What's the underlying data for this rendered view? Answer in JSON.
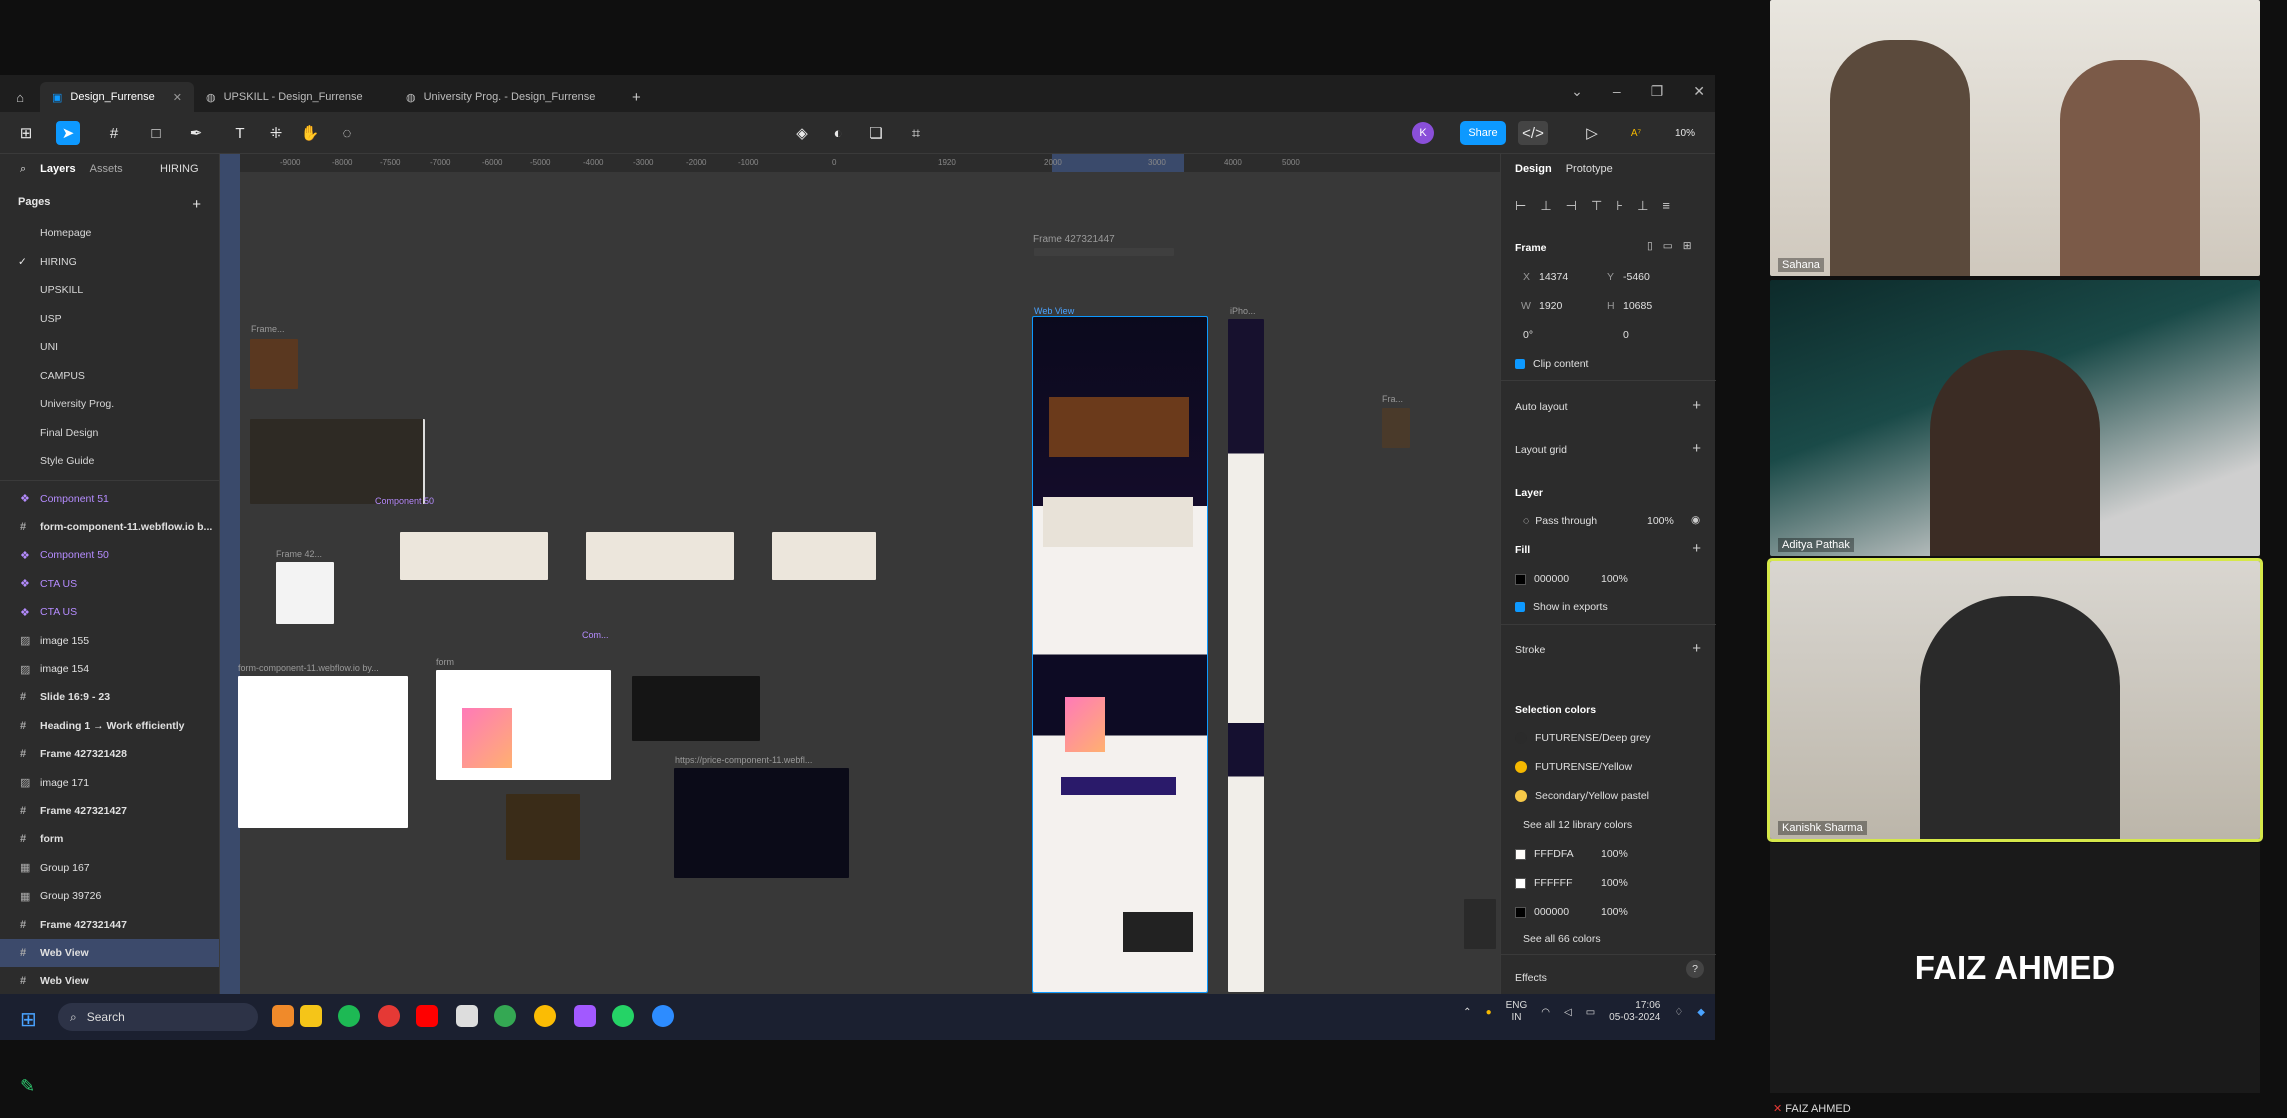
{
  "tabs": [
    "Design_Furrense",
    "UPSKILL - Design_Furrense",
    "University Prog. - Design_Furrense"
  ],
  "toolbar": {
    "share": "Share",
    "avatar": "K",
    "zoom": "10%"
  },
  "left_panel": {
    "tab_layers": "Layers",
    "tab_assets": "Assets",
    "project": "HIRING",
    "pages_title": "Pages",
    "pages": [
      "Homepage",
      "HIRING",
      "UPSKILL",
      "USP",
      "UNI",
      "CAMPUS",
      "University Prog.",
      "Final Design",
      "Style Guide"
    ],
    "layers": [
      {
        "label": "Component 51",
        "kind": "comp"
      },
      {
        "label": "form-component-11.webflow.io b...",
        "kind": "frame"
      },
      {
        "label": "Component 50",
        "kind": "comp"
      },
      {
        "label": "CTA US",
        "kind": "comp"
      },
      {
        "label": "CTA US",
        "kind": "comp"
      },
      {
        "label": "image 155",
        "kind": "image"
      },
      {
        "label": "image 154",
        "kind": "image"
      },
      {
        "label": "Slide 16:9 - 23",
        "kind": "frame"
      },
      {
        "label": "Heading 1 → Work efficiently",
        "kind": "frame"
      },
      {
        "label": "Frame 427321428",
        "kind": "frame"
      },
      {
        "label": "image 171",
        "kind": "image"
      },
      {
        "label": "Frame 427321427",
        "kind": "frame"
      },
      {
        "label": "form",
        "kind": "frame"
      },
      {
        "label": "Group 167",
        "kind": "group"
      },
      {
        "label": "Group 39726",
        "kind": "group"
      },
      {
        "label": "Frame 427321447",
        "kind": "frame"
      },
      {
        "label": "Web View",
        "kind": "frame"
      },
      {
        "label": "Web View",
        "kind": "frame"
      }
    ]
  },
  "rulers": [
    "-9000",
    "-8000",
    "-7500",
    "-7000",
    "-6000",
    "-5000",
    "-4000",
    "-3000",
    "-2000",
    "-1000",
    "0",
    "1920",
    "2000",
    "3000",
    "4000",
    "5000"
  ],
  "canvas": {
    "frame_label_top": "Frame 427321447",
    "web_view_label": "Web View",
    "iphone_label": "iPho...",
    "frame_small_label": "Frame...",
    "component50_label": "Component 50",
    "frame42_label": "Frame 42...",
    "form_label": "form-component-11.webflow.io by...",
    "form2_label": "form",
    "com_label": "Com...",
    "pricing_label": "https://price-component-11.webfl...",
    "fra_label": "Fra..."
  },
  "right_panel": {
    "tab_design": "Design",
    "tab_prototype": "Prototype",
    "frame_title": "Frame",
    "x_label": "X",
    "x_value": "14374",
    "y_label": "Y",
    "y_value": "-5460",
    "w_label": "W",
    "w_value": "1920",
    "h_label": "H",
    "h_value": "10685",
    "rotation": "0°",
    "radius": "0",
    "clip_content": "Clip content",
    "auto_layout": "Auto layout",
    "layout_grid": "Layout grid",
    "layer_title": "Layer",
    "pass_through": "Pass through",
    "layer_opacity": "100%",
    "fill_title": "Fill",
    "fill_hex": "000000",
    "fill_opacity": "100%",
    "show_exports": "Show in exports",
    "stroke_title": "Stroke",
    "selection_colors_title": "Selection colors",
    "library_colors": [
      {
        "name": "FUTURENSE/Deep grey",
        "color": "#2b2b2b"
      },
      {
        "name": "FUTURENSE/Yellow",
        "color": "#f5b800"
      },
      {
        "name": "Secondary/Yellow pastel",
        "color": "#f7c948"
      }
    ],
    "see_all_library": "See all 12 library colors",
    "hex_colors": [
      {
        "hex": "FFFDFA",
        "opacity": "100%",
        "color": "#fffdfa"
      },
      {
        "hex": "FFFFFF",
        "opacity": "100%",
        "color": "#ffffff"
      },
      {
        "hex": "000000",
        "opacity": "100%",
        "color": "#000000"
      }
    ],
    "see_all_colors": "See all 66 colors",
    "effects_title": "Effects"
  },
  "taskbar": {
    "search": "Search",
    "lang": "ENG",
    "region": "IN",
    "time": "17:06",
    "date": "05-03-2024"
  },
  "participants": {
    "p1": "Sahana",
    "p2": "Aditya Pathak",
    "p3": "Kanishk Sharma",
    "p4": "FAIZ AHMED",
    "p4_label": "FAIZ AHMED"
  }
}
